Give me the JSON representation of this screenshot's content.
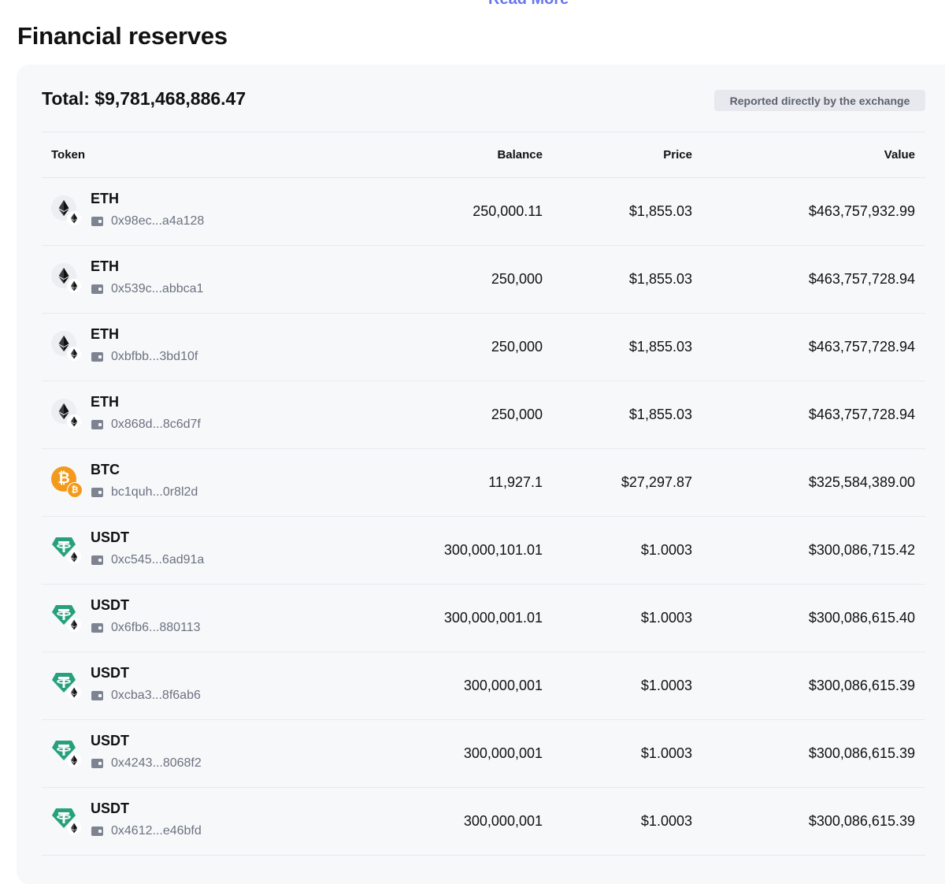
{
  "header": {
    "read_more": "Read More",
    "title": "Financial reserves"
  },
  "summary": {
    "total": "Total: $9,781,468,886.47",
    "badge": "Reported directly by the exchange"
  },
  "table": {
    "columns": {
      "token": "Token",
      "balance": "Balance",
      "price": "Price",
      "value": "Value"
    },
    "rows": [
      {
        "symbol": "ETH",
        "icon": "eth",
        "address": "0x98ec...a4a128",
        "balance": "250,000.11",
        "price": "$1,855.03",
        "value": "$463,757,932.99"
      },
      {
        "symbol": "ETH",
        "icon": "eth",
        "address": "0x539c...abbca1",
        "balance": "250,000",
        "price": "$1,855.03",
        "value": "$463,757,728.94"
      },
      {
        "symbol": "ETH",
        "icon": "eth",
        "address": "0xbfbb...3bd10f",
        "balance": "250,000",
        "price": "$1,855.03",
        "value": "$463,757,728.94"
      },
      {
        "symbol": "ETH",
        "icon": "eth",
        "address": "0x868d...8c6d7f",
        "balance": "250,000",
        "price": "$1,855.03",
        "value": "$463,757,728.94"
      },
      {
        "symbol": "BTC",
        "icon": "btc",
        "address": "bc1quh...0r8l2d",
        "balance": "11,927.1",
        "price": "$27,297.87",
        "value": "$325,584,389.00"
      },
      {
        "symbol": "USDT",
        "icon": "usdt",
        "address": "0xc545...6ad91a",
        "balance": "300,000,101.01",
        "price": "$1.0003",
        "value": "$300,086,715.42"
      },
      {
        "symbol": "USDT",
        "icon": "usdt",
        "address": "0x6fb6...880113",
        "balance": "300,000,001.01",
        "price": "$1.0003",
        "value": "$300,086,615.40"
      },
      {
        "symbol": "USDT",
        "icon": "usdt",
        "address": "0xcba3...8f6ab6",
        "balance": "300,000,001",
        "price": "$1.0003",
        "value": "$300,086,615.39"
      },
      {
        "symbol": "USDT",
        "icon": "usdt",
        "address": "0x4243...8068f2",
        "balance": "300,000,001",
        "price": "$1.0003",
        "value": "$300,086,615.39"
      },
      {
        "symbol": "USDT",
        "icon": "usdt",
        "address": "0x4612...e46bfd",
        "balance": "300,000,001",
        "price": "$1.0003",
        "value": "$300,086,615.39"
      }
    ]
  },
  "colors": {
    "btc": "#f39a1c",
    "usdt": "#26a17b",
    "eth": "#3c3c3d",
    "link": "#6677ee",
    "card_bg": "#f7f8fa"
  }
}
